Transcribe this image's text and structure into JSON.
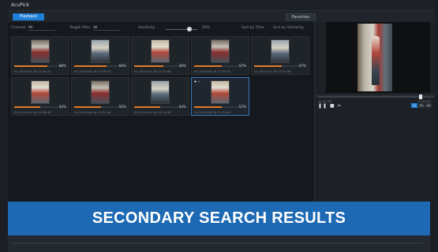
{
  "app": {
    "title": "AcuPick"
  },
  "tabs": {
    "playback": "Playback",
    "favorites": "Favorites"
  },
  "filters": {
    "channel_label": "Channel",
    "channel_value": "All",
    "target_filter_label": "Target Filter",
    "target_filter_value": "All",
    "similarity_label": "Similarity",
    "similarity_value": "50%",
    "sort_by_time": "Sort by Time",
    "sort_by_similarity": "Sort by Similarity"
  },
  "results": [
    {
      "pct": "68%",
      "similarity": 0.68,
      "time": "01-2015-04-18 11:30:21"
    },
    {
      "pct": "66%",
      "similarity": 0.66,
      "time": "01-2015-04-18 11:30:07"
    },
    {
      "pct": "59%",
      "similarity": 0.59,
      "time": "01-2015-04-18 11:27:58"
    },
    {
      "pct": "57%",
      "similarity": 0.57,
      "time": "01-2015-04-18 11:33:07"
    },
    {
      "pct": "57%",
      "similarity": 0.57,
      "time": "01-2015-04-18 11:31:06"
    },
    {
      "pct": "54%",
      "similarity": 0.54,
      "time": "01-2015-04-18 11:28:40"
    },
    {
      "pct": "55%",
      "similarity": 0.55,
      "time": "01-2015-04-18 11:31:56"
    },
    {
      "pct": "54%",
      "similarity": 0.54,
      "time": "01-2015-04-18 11:14:30"
    },
    {
      "pct": "57%",
      "similarity": 0.57,
      "time": "01-2015-04-18 11:31:01"
    }
  ],
  "preview": {
    "time_left": "11:31:00",
    "time_right": "11:31:01",
    "controls": "❚❚ ■ ✂",
    "speeds": [
      "1x",
      "2x",
      "4x"
    ],
    "playback_progress": 0.88
  },
  "banner": {
    "text": "SECONDARY SEARCH RESULTS",
    "color": "#1d69b3"
  },
  "colors": {
    "accent": "#1f7fd6",
    "bar": "#e07a2a"
  }
}
